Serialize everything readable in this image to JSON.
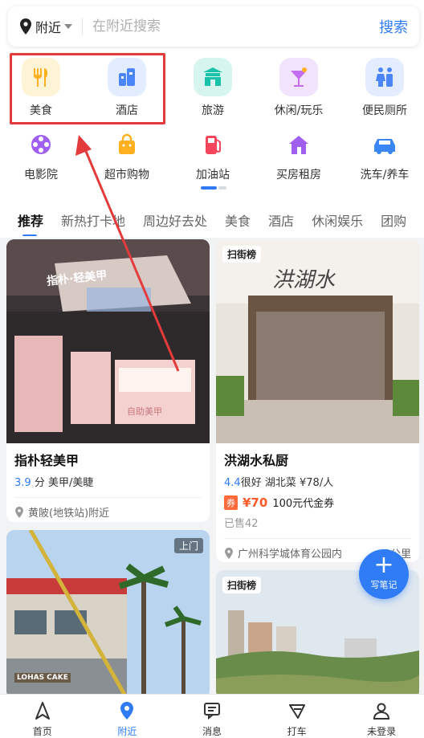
{
  "search": {
    "location": "附近",
    "placeholder": "在附近搜索",
    "button": "搜索"
  },
  "categories_row1": [
    {
      "label": "美食",
      "icon": "fork-knife-icon",
      "color": "#ffb020"
    },
    {
      "label": "酒店",
      "icon": "building-icon",
      "color": "#4a86f7"
    },
    {
      "label": "旅游",
      "icon": "temple-icon",
      "color": "#19c2a8"
    },
    {
      "label": "休闲/玩乐",
      "icon": "cocktail-icon",
      "color": "#c36cf0"
    },
    {
      "label": "便民厕所",
      "icon": "restroom-icon",
      "color": "#4a86f7"
    }
  ],
  "categories_row2": [
    {
      "label": "电影院",
      "icon": "film-reel-icon",
      "color": "#a15ff0"
    },
    {
      "label": "超市购物",
      "icon": "shopping-bag-icon",
      "color": "#ffb020"
    },
    {
      "label": "加油站",
      "icon": "gas-pump-icon",
      "color": "#f5455a"
    },
    {
      "label": "买房租房",
      "icon": "house-icon",
      "color": "#a15ff0"
    },
    {
      "label": "洗车/养车",
      "icon": "car-icon",
      "color": "#3a86f5"
    }
  ],
  "tabs": [
    "推荐",
    "新热打卡地",
    "周边好去处",
    "美食",
    "酒店",
    "休闲娱乐",
    "团购"
  ],
  "cards": {
    "c1": {
      "title": "指朴轻美甲",
      "score": "3.9",
      "score_unit": "分",
      "category": "美甲/美睫",
      "address": "黄陂(地铁站)附近",
      "sign_text": "指朴·轻美甲",
      "counter_text": "自助美甲"
    },
    "c2": {
      "badge": "扫街榜",
      "title": "洪湖水私厨",
      "score": "4.4",
      "score_word": "很好",
      "category": "湖北菜",
      "price": "¥78/人",
      "coupon_tag": "券",
      "coupon_price": "¥70",
      "coupon_desc": "100元代金券",
      "sold": "已售42",
      "address": "广州科学城体育公园内",
      "distance": "3公里",
      "sign_text": "洪湖水"
    },
    "c3": {
      "badge": "上门",
      "shop_sign": "LOHAS CAKE"
    },
    "c4": {
      "badge": "扫街榜"
    }
  },
  "fab": {
    "label": "写笔记"
  },
  "bottom_nav": [
    {
      "label": "首页",
      "icon": "navigate-arrow-icon"
    },
    {
      "label": "附近",
      "icon": "location-pin-icon"
    },
    {
      "label": "消息",
      "icon": "message-icon"
    },
    {
      "label": "打车",
      "icon": "taxi-icon"
    },
    {
      "label": "未登录",
      "icon": "user-icon"
    }
  ],
  "colors": {
    "accent": "#2f7cf6",
    "annotation": "#e33b3b",
    "coupon": "#ff5a2a"
  }
}
